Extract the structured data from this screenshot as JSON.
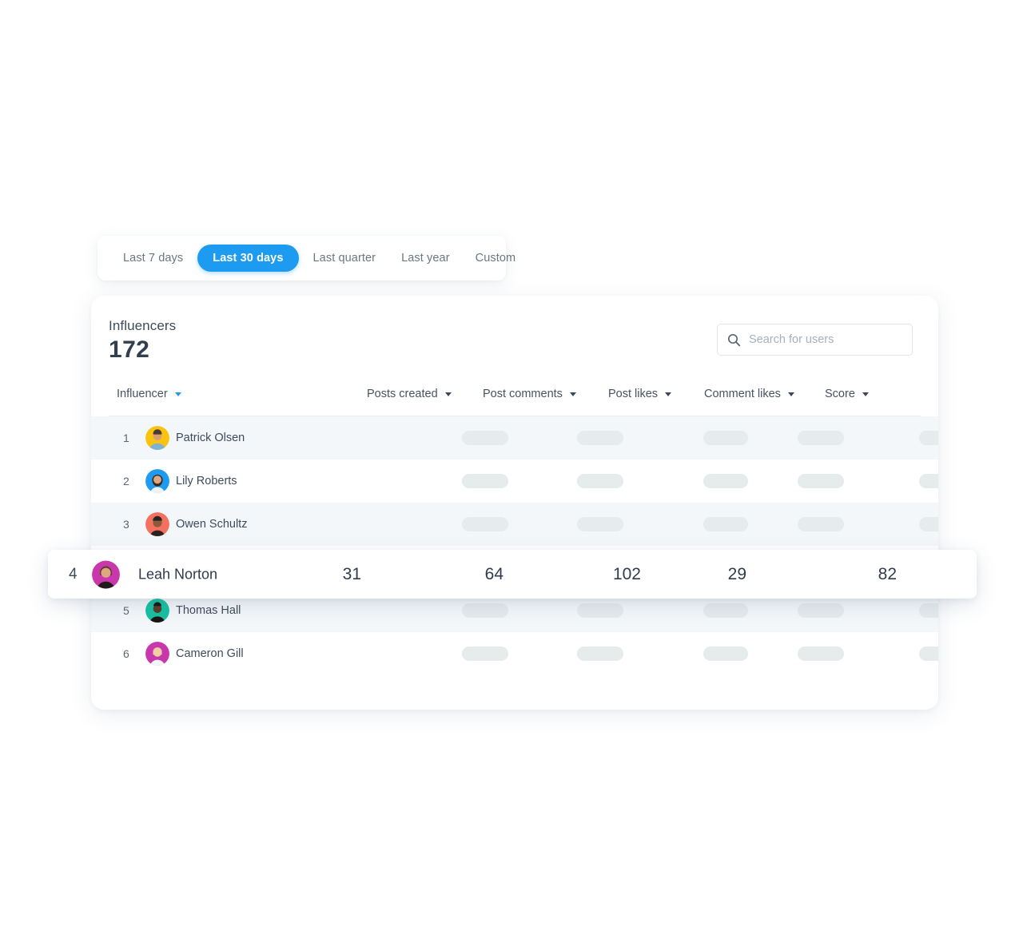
{
  "date_filter": {
    "options": [
      {
        "label": "Last 7 days",
        "active": false
      },
      {
        "label": "Last 30 days",
        "active": true
      },
      {
        "label": "Last quarter",
        "active": false
      },
      {
        "label": "Last year",
        "active": false
      },
      {
        "label": "Custom",
        "active": false
      }
    ],
    "active_label": "Last 30 days",
    "accent_color": "#1c9bf0"
  },
  "card": {
    "title": "Influencers",
    "count": "172",
    "search": {
      "placeholder": "Search for users",
      "value": "",
      "icon": "search-icon"
    }
  },
  "table": {
    "columns": [
      {
        "label": "Influencer",
        "sort_icon": "chevron-down-icon",
        "sort_active": true
      },
      {
        "label": "Posts created",
        "sort_icon": "chevron-down-icon",
        "sort_active": false
      },
      {
        "label": "Post comments",
        "sort_icon": "chevron-down-icon",
        "sort_active": false
      },
      {
        "label": "Post likes",
        "sort_icon": "chevron-down-icon",
        "sort_active": false
      },
      {
        "label": "Comment likes",
        "sort_icon": "chevron-down-icon",
        "sort_active": false
      },
      {
        "label": "Score",
        "sort_icon": "chevron-down-icon",
        "sort_active": false
      }
    ],
    "rows": [
      {
        "rank": "1",
        "name": "Patrick Olsen",
        "avatar_color": "#fac312",
        "masked": true
      },
      {
        "rank": "2",
        "name": "Lily Roberts",
        "avatar_color": "#1c9bf0",
        "masked": true
      },
      {
        "rank": "3",
        "name": "Owen Schultz",
        "avatar_color": "#f4705f",
        "masked": true
      },
      {
        "rank": "5",
        "name": "Thomas Hall",
        "avatar_color": "#17c1a0",
        "masked": true
      },
      {
        "rank": "6",
        "name": "Cameron Gill",
        "avatar_color": "#c837ab",
        "masked": true
      }
    ],
    "highlighted_row": {
      "rank": "4",
      "name": "Leah Norton",
      "avatar_color": "#c837ab",
      "posts_created": "31",
      "post_comments": "64",
      "post_likes": "102",
      "comment_likes": "29",
      "score": "82"
    }
  }
}
